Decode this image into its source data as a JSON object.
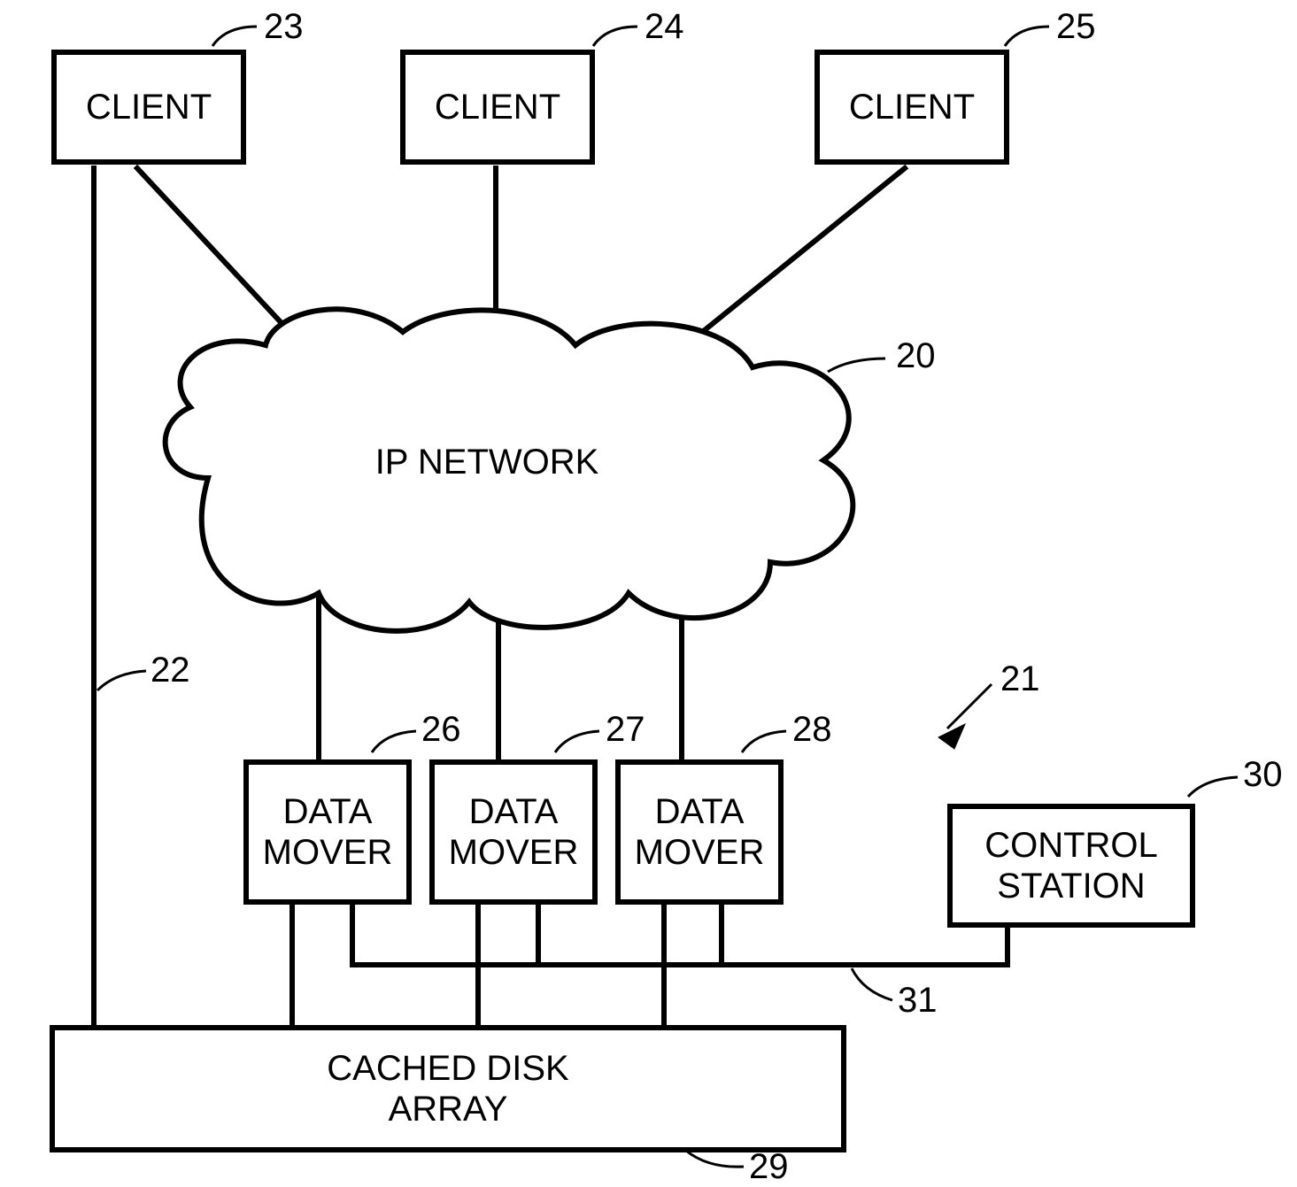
{
  "nodes": {
    "client1": {
      "label": "CLIENT",
      "ref": "23"
    },
    "client2": {
      "label": "CLIENT",
      "ref": "24"
    },
    "client3": {
      "label": "CLIENT",
      "ref": "25"
    },
    "ipnetwork": {
      "label": "IP NETWORK",
      "ref": "20"
    },
    "datamover1": {
      "label": "DATA\nMOVER",
      "ref": "26"
    },
    "datamover2": {
      "label": "DATA\nMOVER",
      "ref": "27"
    },
    "datamover3": {
      "label": "DATA\nMOVER",
      "ref": "28"
    },
    "controlstation": {
      "label": "CONTROL\nSTATION",
      "ref": "30"
    },
    "cacheddiskarray": {
      "label": "CACHED DISK\nARRAY",
      "ref": "29"
    }
  },
  "edges": {
    "leftlink": {
      "ref": "22"
    },
    "sysref": {
      "ref": "21"
    },
    "internalbus": {
      "ref": "31"
    }
  }
}
